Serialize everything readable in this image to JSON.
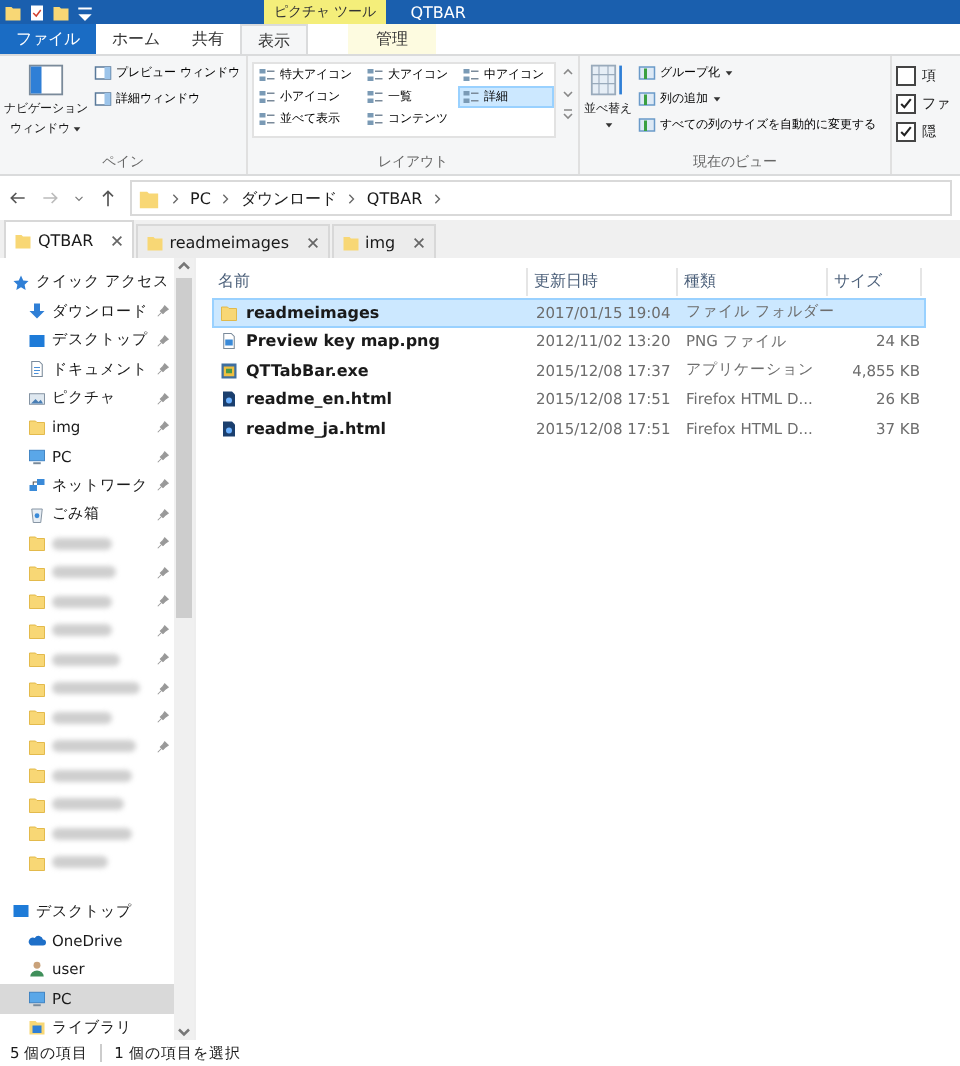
{
  "title_bar": {
    "context_tab": "ピクチャ ツール",
    "title": "QTBAR"
  },
  "ribbon_tabs": [
    {
      "label": "ファイル",
      "kind": "file",
      "selected": false
    },
    {
      "label": "ホーム",
      "kind": "plain",
      "selected": false
    },
    {
      "label": "共有",
      "kind": "plain",
      "selected": false
    },
    {
      "label": "表示",
      "kind": "plain",
      "selected": true
    },
    {
      "label": "管理",
      "kind": "context",
      "selected": false
    }
  ],
  "pane_group": {
    "label": "ペイン",
    "large_button_lines": [
      "ナビゲーション",
      "ウィンドウ"
    ],
    "buttons": [
      "プレビュー ウィンドウ",
      "詳細ウィンドウ"
    ]
  },
  "layout_group": {
    "label": "レイアウト",
    "options": [
      {
        "label": "特大アイコン",
        "selected": false
      },
      {
        "label": "大アイコン",
        "selected": false
      },
      {
        "label": "中アイコン",
        "selected": false
      },
      {
        "label": "小アイコン",
        "selected": false
      },
      {
        "label": "一覧",
        "selected": false
      },
      {
        "label": "詳細",
        "selected": true
      },
      {
        "label": "並べて表示",
        "selected": false
      },
      {
        "label": "コンテンツ",
        "selected": false
      }
    ]
  },
  "view_group": {
    "label": "現在のビュー",
    "large_button": "並べ替え",
    "buttons": [
      {
        "label": "グループ化",
        "dropdown": true
      },
      {
        "label": "列の追加",
        "dropdown": true
      },
      {
        "label": "すべての列のサイズを自動的に変更する",
        "dropdown": false
      }
    ]
  },
  "show_hide_group": {
    "checkboxes": [
      {
        "label": "項",
        "checked": false
      },
      {
        "label": "ファ",
        "checked": true
      },
      {
        "label": "隠",
        "checked": true
      }
    ]
  },
  "address_bar": {
    "segments": [
      "PC",
      "ダウンロード",
      "QTBAR"
    ]
  },
  "folder_tabs": [
    {
      "label": "QTBAR",
      "selected": true
    },
    {
      "label": "readmeimages",
      "selected": false
    },
    {
      "label": "img",
      "selected": false
    }
  ],
  "navigation_sections": [
    {
      "items": [
        {
          "label": "クイック アクセス",
          "kind": "star",
          "pinned": false,
          "selected": false
        },
        {
          "label": "ダウンロード",
          "kind": "download",
          "pinned": true,
          "selected": false
        },
        {
          "label": "デスクトップ",
          "kind": "desktop",
          "pinned": true,
          "selected": false
        },
        {
          "label": "ドキュメント",
          "kind": "document",
          "pinned": true,
          "selected": false
        },
        {
          "label": "ピクチャ",
          "kind": "picture",
          "pinned": true,
          "selected": false
        },
        {
          "label": "img",
          "kind": "folder",
          "pinned": true,
          "selected": false
        },
        {
          "label": "PC",
          "kind": "pc",
          "pinned": true,
          "selected": false
        },
        {
          "label": "ネットワーク",
          "kind": "network",
          "pinned": true,
          "selected": false
        },
        {
          "label": "ごみ箱",
          "kind": "recycle",
          "pinned": true,
          "selected": false
        },
        {
          "kind": "blurred",
          "pinned": true,
          "selected": false
        },
        {
          "kind": "blurred",
          "pinned": true,
          "selected": false
        },
        {
          "kind": "blurred",
          "pinned": true,
          "selected": false
        },
        {
          "kind": "blurred",
          "pinned": true,
          "selected": false
        },
        {
          "kind": "blurred",
          "pinned": true,
          "selected": false
        },
        {
          "kind": "blurred",
          "pinned": true,
          "selected": false
        },
        {
          "kind": "blurred",
          "pinned": true,
          "selected": false
        },
        {
          "kind": "blurred",
          "pinned": true,
          "selected": false
        },
        {
          "kind": "blurred",
          "pinned": false,
          "selected": false
        },
        {
          "kind": "blurred",
          "pinned": false,
          "selected": false
        },
        {
          "kind": "blurred",
          "pinned": false,
          "selected": false
        },
        {
          "kind": "blurred",
          "pinned": false,
          "selected": false
        }
      ]
    },
    {
      "items": [
        {
          "label": "デスクトップ",
          "kind": "desktop",
          "pinned": false,
          "selected": false
        },
        {
          "label": "OneDrive",
          "kind": "onedrive",
          "pinned": false,
          "selected": false
        },
        {
          "label": "user",
          "kind": "user",
          "pinned": false,
          "selected": false
        },
        {
          "label": "PC",
          "kind": "pc",
          "pinned": false,
          "selected": true
        },
        {
          "label": "ライブラリ",
          "kind": "library",
          "pinned": false,
          "selected": false
        }
      ]
    }
  ],
  "file_list": {
    "columns": [
      "名前",
      "更新日時",
      "種類",
      "サイズ"
    ],
    "rows": [
      {
        "name": "readmeimages",
        "modified": "2017/01/15 19:04",
        "type": "ファイル フォルダー",
        "size": "",
        "kind": "folder",
        "selected": true
      },
      {
        "name": "Preview key map.png",
        "modified": "2012/11/02 13:20",
        "type": "PNG ファイル",
        "size": "24 KB",
        "kind": "image",
        "selected": false
      },
      {
        "name": "QTTabBar.exe",
        "modified": "2015/12/08 17:37",
        "type": "アプリケーション",
        "size": "4,855 KB",
        "kind": "app",
        "selected": false
      },
      {
        "name": "readme_en.html",
        "modified": "2015/12/08 17:51",
        "type": "Firefox HTML D...",
        "size": "26 KB",
        "kind": "html",
        "selected": false
      },
      {
        "name": "readme_ja.html",
        "modified": "2015/12/08 17:51",
        "type": "Firefox HTML D...",
        "size": "37 KB",
        "kind": "html",
        "selected": false
      }
    ]
  },
  "status_bar": {
    "item_count": "5 個の項目",
    "selection": "1 個の項目を選択"
  }
}
